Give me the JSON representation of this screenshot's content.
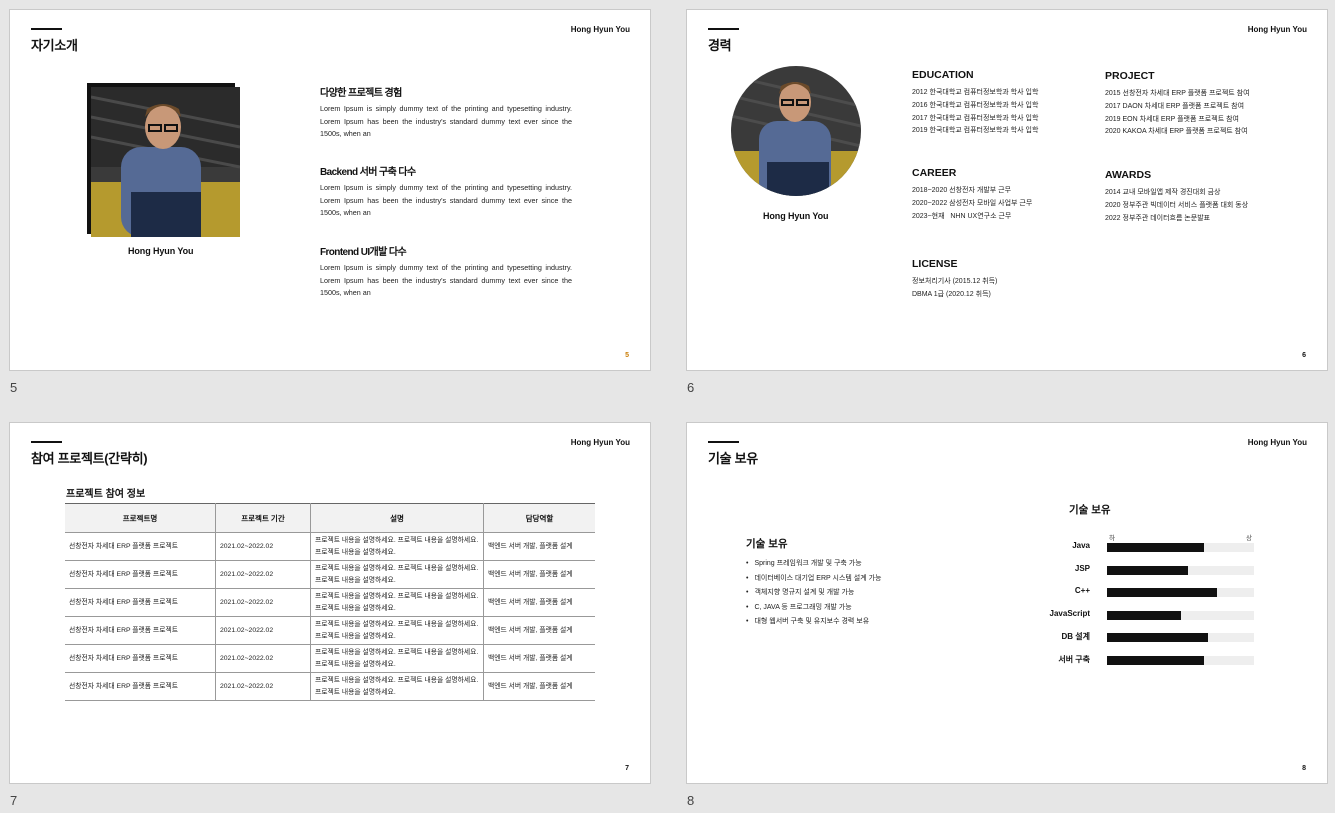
{
  "slides": [
    {
      "num": "5"
    },
    {
      "num": "6"
    },
    {
      "num": "7"
    },
    {
      "num": "8"
    }
  ],
  "author": "Hong Hyun You",
  "s5": {
    "title": "자기소개",
    "page": "5",
    "name": "Hong Hyun You",
    "features": [
      {
        "title": "다양한 프로젝트 경험",
        "text": "Lorem Ipsum is simply dummy text of the printing and typesetting industry. Lorem Ipsum has been the industry's standard dummy text ever since the 1500s, when an"
      },
      {
        "title": "Backend 서버 구축 다수",
        "text": "Lorem Ipsum is simply dummy text of the printing and typesetting industry. Lorem Ipsum has been the industry's standard dummy text ever since the 1500s, when an"
      },
      {
        "title": "Frontend UI개발 다수",
        "text": "Lorem Ipsum is simply dummy text of the printing and typesetting industry. Lorem Ipsum has been the industry's standard dummy text ever since the 1500s, when an"
      }
    ]
  },
  "s6": {
    "title": "경력",
    "page": "6",
    "name": "Hong Hyun You",
    "education": {
      "head": "EDUCATION",
      "lines": [
        "2012 한국대학교 컴퓨터정보학과 학사 입학",
        "2016 한국대학교 컴퓨터정보학과 학사 입학",
        "2017 한국대학교 컴퓨터정보학과 학사 입학",
        "2019 한국대학교 컴퓨터정보학과 학사 입학"
      ]
    },
    "project": {
      "head": "PROJECT",
      "lines": [
        "2015 선창전자 차세대 ERP 플랫폼 프로젝트 참여",
        "2017 DAON 차세대 ERP 플랫폼 프로젝트 참여",
        "2019 EON 차세대 ERP 플랫폼 프로젝트 참여",
        "2020 KAKOA 차세대 ERP 플랫폼 프로젝트 참여"
      ]
    },
    "career": {
      "head": "CAREER",
      "lines": [
        "2018~2020 선창전자 개발부 근무",
        "2020~2022 삼성전자 모바일 사업부 근무",
        "2023~현재   NHN UX연구소 근무"
      ]
    },
    "awards": {
      "head": "AWARDS",
      "lines": [
        "2014 교내 모바일앱 제작 경진대회 금상",
        "2020 정부주관 빅데이터 서비스 플랫폼 대회 동상",
        "2022 정부주관 데이터흐름 논문발표"
      ]
    },
    "license": {
      "head": "LICENSE",
      "lines": [
        "정보처리기사 (2015.12 취득)",
        "DBMA 1급 (2020.12 취득)"
      ]
    }
  },
  "s7": {
    "title": "참여 프로젝트(간략히)",
    "page": "7",
    "table_title": "프로젝트 참여 정보",
    "columns": [
      "프로젝트명",
      "프로젝트 기간",
      "설명",
      "담당역할"
    ],
    "rows": [
      [
        "선창전자 차세대 ERP 플랫폼 프로젝트",
        "2021.02~2022.02",
        "프로젝트 내용을 설명하세요. 프로젝트 내용을 설명하세요. 프로젝트 내용을 설명하세요.",
        "백엔드 서버 개발, 플랫폼 설계"
      ],
      [
        "선창전자 차세대 ERP 플랫폼 프로젝트",
        "2021.02~2022.02",
        "프로젝트 내용을 설명하세요. 프로젝트 내용을 설명하세요. 프로젝트 내용을 설명하세요.",
        "백엔드 서버 개발, 플랫폼 설계"
      ],
      [
        "선창전자 차세대 ERP 플랫폼 프로젝트",
        "2021.02~2022.02",
        "프로젝트 내용을 설명하세요. 프로젝트 내용을 설명하세요. 프로젝트 내용을 설명하세요.",
        "백엔드 서버 개발, 플랫폼 설계"
      ],
      [
        "선창전자 차세대 ERP 플랫폼 프로젝트",
        "2021.02~2022.02",
        "프로젝트 내용을 설명하세요. 프로젝트 내용을 설명하세요. 프로젝트 내용을 설명하세요.",
        "백엔드 서버 개발, 플랫폼 설계"
      ],
      [
        "선창전자 차세대 ERP 플랫폼 프로젝트",
        "2021.02~2022.02",
        "프로젝트 내용을 설명하세요. 프로젝트 내용을 설명하세요. 프로젝트 내용을 설명하세요.",
        "백엔드 서버 개발, 플랫폼 설계"
      ],
      [
        "선창전자 차세대 ERP 플랫폼 프로젝트",
        "2021.02~2022.02",
        "프로젝트 내용을 설명하세요. 프로젝트 내용을 설명하세요. 프로젝트 내용을 설명하세요.",
        "백엔드 서버 개발, 플랫폼 설계"
      ]
    ]
  },
  "s8": {
    "title": "기술 보유",
    "page": "8",
    "list_head": "기술 보유",
    "items": [
      "Spring 프레임워크 개발 및 구축 가능",
      "데이터베이스 대기업 ERP 시스템 설계 가능",
      "객체지향 명규지 설계 및 개발 가능",
      "C, JAVA 등 프로그래밍 개발 가능",
      "대형 웹서버 구축 및 유지보수 경력 보유"
    ],
    "chart_title": "기술 보유",
    "scale_low": "하",
    "scale_high": "상"
  },
  "chart_data": {
    "type": "bar",
    "title": "기술 보유",
    "orientation": "horizontal",
    "categories": [
      "Java",
      "JSP",
      "C++",
      "JavaScript",
      "DB 설계",
      "서버 구축"
    ],
    "values": [
      0.66,
      0.55,
      0.75,
      0.5,
      0.69,
      0.66
    ],
    "scale_labels": [
      "하",
      "상"
    ],
    "ylim": [
      0,
      1
    ],
    "bar_color": "#111111",
    "track_color": "#eeeeee"
  }
}
